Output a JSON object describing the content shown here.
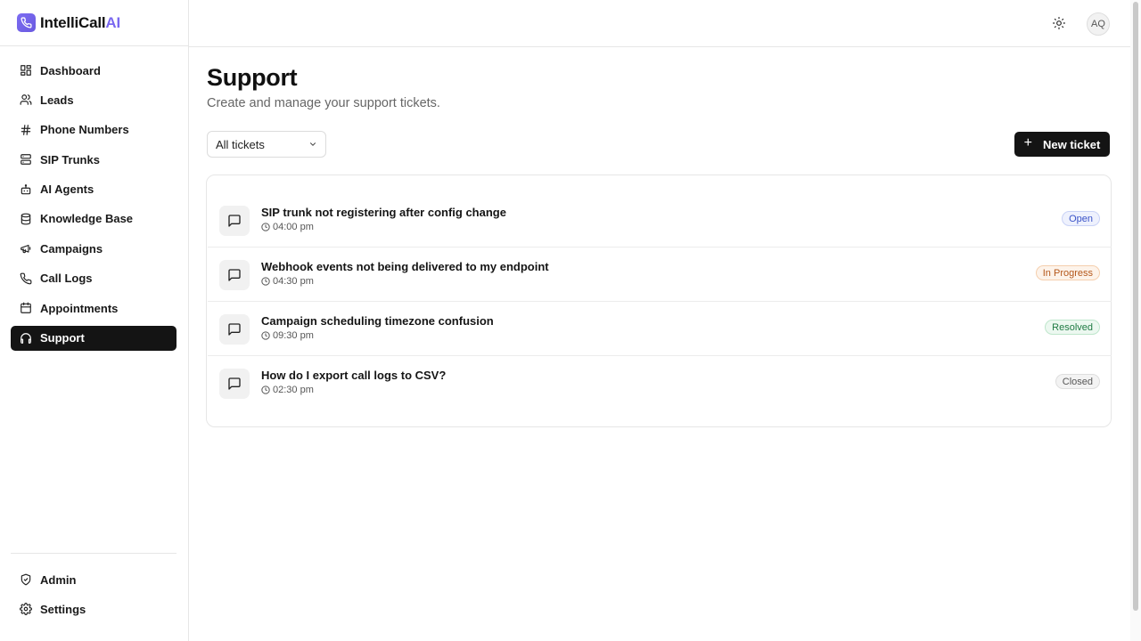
{
  "brand": {
    "name": "IntelliCall",
    "suffix": "AI"
  },
  "sidebar": {
    "items": [
      {
        "label": "Dashboard",
        "icon": "dashboard-icon"
      },
      {
        "label": "Leads",
        "icon": "users-icon"
      },
      {
        "label": "Phone Numbers",
        "icon": "hash-icon"
      },
      {
        "label": "SIP Trunks",
        "icon": "server-icon"
      },
      {
        "label": "AI Agents",
        "icon": "bot-icon"
      },
      {
        "label": "Knowledge Base",
        "icon": "database-icon"
      },
      {
        "label": "Campaigns",
        "icon": "megaphone-icon"
      },
      {
        "label": "Call Logs",
        "icon": "phone-icon"
      },
      {
        "label": "Appointments",
        "icon": "calendar-icon"
      },
      {
        "label": "Support",
        "icon": "headphones-icon",
        "active": true
      }
    ],
    "bottom": [
      {
        "label": "Admin",
        "icon": "shield-icon"
      },
      {
        "label": "Settings",
        "icon": "gear-icon"
      }
    ]
  },
  "header": {
    "theme_icon": "sun-icon",
    "avatar_initials": "AQ"
  },
  "page": {
    "title": "Support",
    "subtitle": "Create and manage your support tickets."
  },
  "filter": {
    "selected": "All tickets"
  },
  "new_ticket_label": "New ticket",
  "tickets": [
    {
      "title": "SIP trunk not registering after config change",
      "time": "04:00 pm",
      "status": "Open",
      "status_color": "#3a53c8",
      "status_bg": "#eef1fd",
      "status_border": "#c9d2f6"
    },
    {
      "title": "Webhook events not being delivered to my endpoint",
      "time": "04:30 pm",
      "status": "In Progress",
      "status_color": "#b4571a",
      "status_bg": "#fdf3ea",
      "status_border": "#f5cfae"
    },
    {
      "title": "Campaign scheduling timezone confusion",
      "time": "09:30 pm",
      "status": "Resolved",
      "status_color": "#1f7a43",
      "status_bg": "#ecf8f0",
      "status_border": "#bfe6cc"
    },
    {
      "title": "How do I export call logs to CSV?",
      "time": "02:30 pm",
      "status": "Closed",
      "status_color": "#555555",
      "status_bg": "#f3f3f3",
      "status_border": "#dedede"
    }
  ]
}
